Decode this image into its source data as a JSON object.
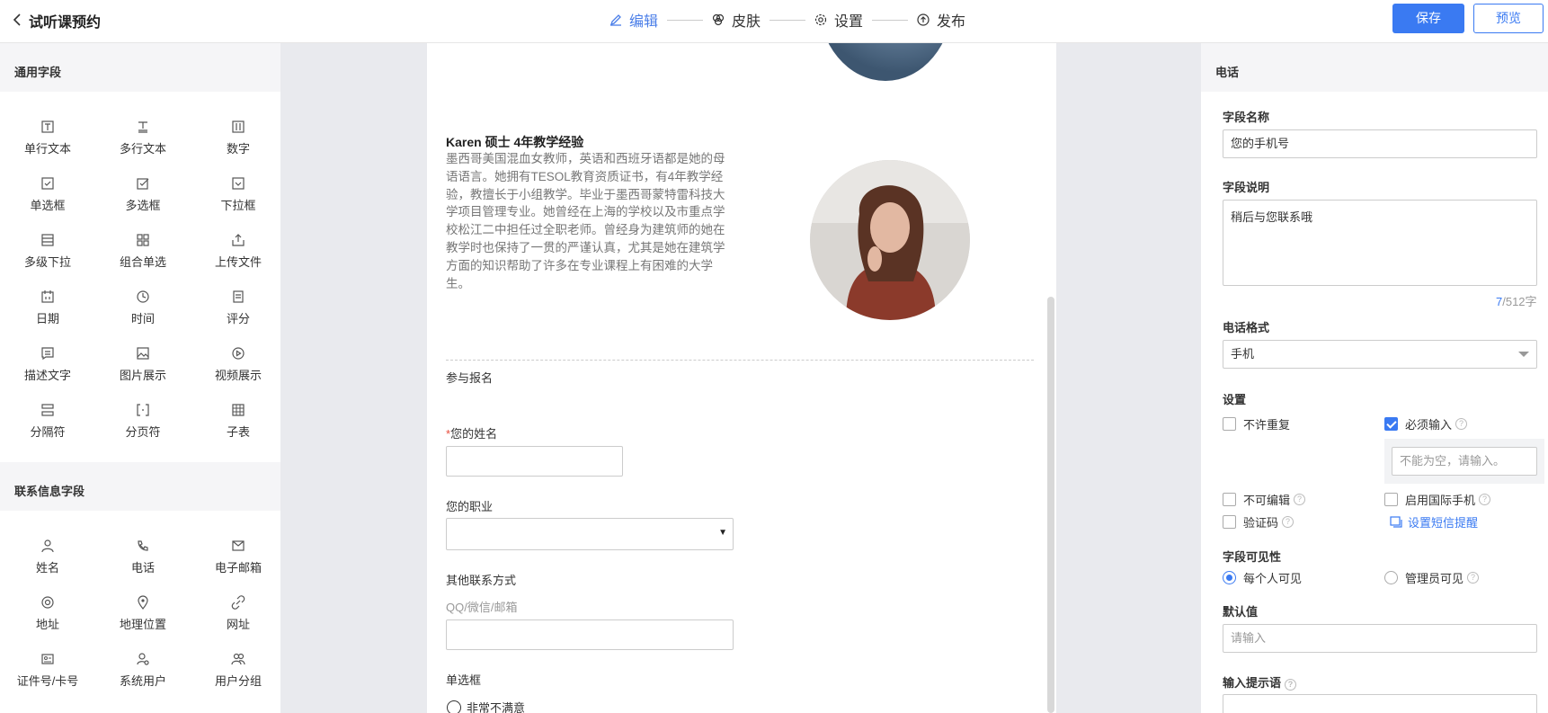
{
  "header": {
    "title": "试听课预约",
    "steps": [
      {
        "label": "编辑",
        "icon": "edit-icon",
        "active": true
      },
      {
        "label": "皮肤",
        "icon": "palette-icon",
        "active": false
      },
      {
        "label": "设置",
        "icon": "gear-icon",
        "active": false
      },
      {
        "label": "发布",
        "icon": "publish-icon",
        "active": false
      }
    ],
    "save_label": "保存",
    "preview_label": "预览"
  },
  "left_panel": {
    "general_title": "通用字段",
    "general_fields": [
      {
        "label": "单行文本",
        "icon": "single-line-text-icon"
      },
      {
        "label": "多行文本",
        "icon": "multi-line-text-icon"
      },
      {
        "label": "数字",
        "icon": "number-icon"
      },
      {
        "label": "单选框",
        "icon": "radio-icon"
      },
      {
        "label": "多选框",
        "icon": "checkbox-icon"
      },
      {
        "label": "下拉框",
        "icon": "dropdown-icon"
      },
      {
        "label": "多级下拉",
        "icon": "cascade-dropdown-icon"
      },
      {
        "label": "组合单选",
        "icon": "grid-radio-icon"
      },
      {
        "label": "上传文件",
        "icon": "upload-icon"
      },
      {
        "label": "日期",
        "icon": "calendar-icon"
      },
      {
        "label": "时间",
        "icon": "clock-icon"
      },
      {
        "label": "评分",
        "icon": "rating-icon"
      },
      {
        "label": "描述文字",
        "icon": "description-icon"
      },
      {
        "label": "图片展示",
        "icon": "image-icon"
      },
      {
        "label": "视频展示",
        "icon": "video-icon"
      },
      {
        "label": "分隔符",
        "icon": "separator-icon"
      },
      {
        "label": "分页符",
        "icon": "page-break-icon"
      },
      {
        "label": "子表",
        "icon": "subtable-icon"
      }
    ],
    "contact_title": "联系信息字段",
    "contact_fields": [
      {
        "label": "姓名",
        "icon": "person-icon"
      },
      {
        "label": "电话",
        "icon": "phone-icon"
      },
      {
        "label": "电子邮箱",
        "icon": "mail-icon"
      },
      {
        "label": "地址",
        "icon": "address-icon"
      },
      {
        "label": "地理位置",
        "icon": "location-pin-icon"
      },
      {
        "label": "网址",
        "icon": "link-icon"
      },
      {
        "label": "证件号/卡号",
        "icon": "id-card-icon"
      },
      {
        "label": "系统用户",
        "icon": "system-user-icon"
      },
      {
        "label": "用户分组",
        "icon": "user-group-icon"
      }
    ]
  },
  "form": {
    "teacher_name": "Karen  硕士  4年教学经验",
    "teacher_bio": "墨西哥美国混血女教师，英语和西班牙语都是她的母语语言。她拥有TESOL教育资质证书，有4年教学经验，教擅长于小组教学。毕业于墨西哥蒙特雷科技大学项目管理专业。她曾经在上海的学校以及市重点学校松江二中担任过全职老师。曾经身为建筑师的她在教学时也保持了一贯的严谨认真，尤其是她在建筑学方面的知识帮助了许多在专业课程上有困难的大学生。",
    "section_title": "参与报名",
    "name_required_mark": "*",
    "name_label": "您的姓名",
    "job_label": "您的职业",
    "other_contact_label": "其他联系方式",
    "other_contact_hint": "QQ/微信/邮箱",
    "radio_label": "单选框",
    "radio_option1": "非常不满意"
  },
  "right_panel": {
    "section_title": "电话",
    "field_name_label": "字段名称",
    "field_name_value": "您的手机号",
    "field_desc_label": "字段说明",
    "field_desc_value": "稍后与您联系哦",
    "counter_current": "7",
    "counter_total": "/512字",
    "phone_format_label": "电话格式",
    "phone_format_value": "手机",
    "settings_label": "设置",
    "no_duplicate": "不许重复",
    "required": "必须输入",
    "required_placeholder": "不能为空，请输入。",
    "not_editable": "不可编辑",
    "intl_phone": "启用国际手机",
    "verify_code": "验证码",
    "sms_reminder": "设置短信提醒",
    "visibility_label": "字段可见性",
    "visible_all": "每个人可见",
    "visible_admin": "管理员可见",
    "default_label": "默认值",
    "default_placeholder": "请输入",
    "input_hint_label": "输入提示语"
  }
}
